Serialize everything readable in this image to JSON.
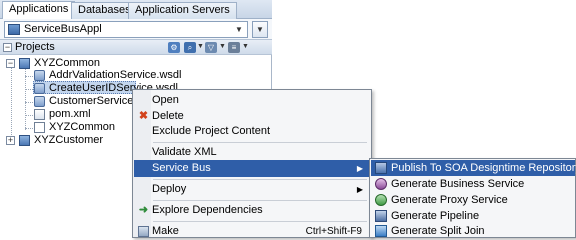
{
  "tabs": [
    {
      "label": "Applications",
      "active": true
    },
    {
      "label": "Databases",
      "active": false
    },
    {
      "label": "Application Servers",
      "active": false
    }
  ],
  "app_selector": {
    "value": "ServiceBusAppl"
  },
  "projects_panel": {
    "title": "Projects"
  },
  "tree": {
    "xyzcommon": "XYZCommon",
    "addr": "AddrValidationService.wsdl",
    "createuser": "CreateUserIDService.wsdl",
    "customer": "CustomerService.wsdl",
    "pom": "pom.xml",
    "xyzcommon_sb": "XYZCommon",
    "xyzcustomer": "XYZCustomer"
  },
  "context_menu": {
    "open": "Open",
    "delete": "Delete",
    "exclude": "Exclude Project Content",
    "validate": "Validate XML",
    "service_bus": "Service Bus",
    "deploy": "Deploy",
    "explore": "Explore Dependencies",
    "make": "Make",
    "make_shortcut": "Ctrl+Shift-F9"
  },
  "submenu": {
    "publish": "Publish To SOA Designtime Repository",
    "gen_business": "Generate Business Service",
    "gen_proxy": "Generate Proxy Service",
    "gen_pipeline": "Generate Pipeline",
    "gen_split": "Generate Split Join"
  },
  "icons": {
    "app": "application-icon",
    "folder": "project-folder-icon",
    "wsdl": "wsdl-file-icon",
    "xml": "xml-file-icon",
    "delete": "red-x-delete-icon",
    "dependencies": "green-arrow-icon"
  },
  "colors": {
    "highlight": "#2f5ea8",
    "selection": "#c3d6ee"
  }
}
